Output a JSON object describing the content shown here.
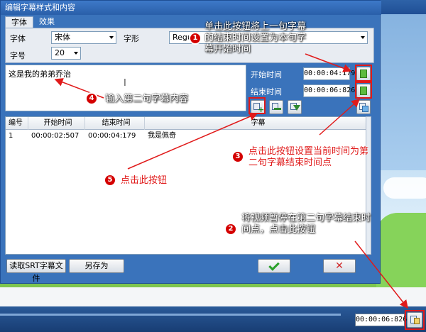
{
  "dialog": {
    "title": "编辑字幕样式和内容",
    "tabs": [
      "字体",
      "效果"
    ],
    "font": {
      "font_label": "字体",
      "font_value": "宋体",
      "style_label": "字形",
      "style_value": "Regu",
      "size_label": "字号",
      "size_value": "20"
    },
    "text": {
      "content": "这是我的弟弟乔治"
    },
    "timing": {
      "start_label": "开始时间",
      "start_value": "00:00:04:179",
      "end_label": "结束时间",
      "end_value": "00:00:06:826"
    },
    "table": {
      "headers": [
        "编号",
        "开始时间",
        "结束时间",
        "字幕"
      ],
      "rows": [
        [
          "1",
          "00:00:02:507",
          "00:00:04:179",
          "我是佩奇"
        ]
      ]
    },
    "footer": {
      "load_srt": "读取SRT字幕文件",
      "save_as": "另存为"
    }
  },
  "player": {
    "time": "00:00:06:826"
  },
  "annotations": {
    "a1": {
      "num": "1",
      "text": "单击此按钮将上一句字幕的结束时间设置为本句字幕开始时间"
    },
    "a2": {
      "num": "2",
      "text": "将视频暂停在第二句字幕结束时间点，点击此按钮"
    },
    "a3": {
      "num": "3",
      "text": "点击此按钮设置当前时间为第二句字幕结束时间点"
    },
    "a4": {
      "num": "4",
      "text": "输入第二句字幕内容"
    },
    "a5": {
      "num": "5",
      "text": "点击此按钮"
    }
  },
  "colors": {
    "annotation": "#e01a1a",
    "dialog_bg": "#3a73bb",
    "title_bar": "#2a5fa9"
  }
}
